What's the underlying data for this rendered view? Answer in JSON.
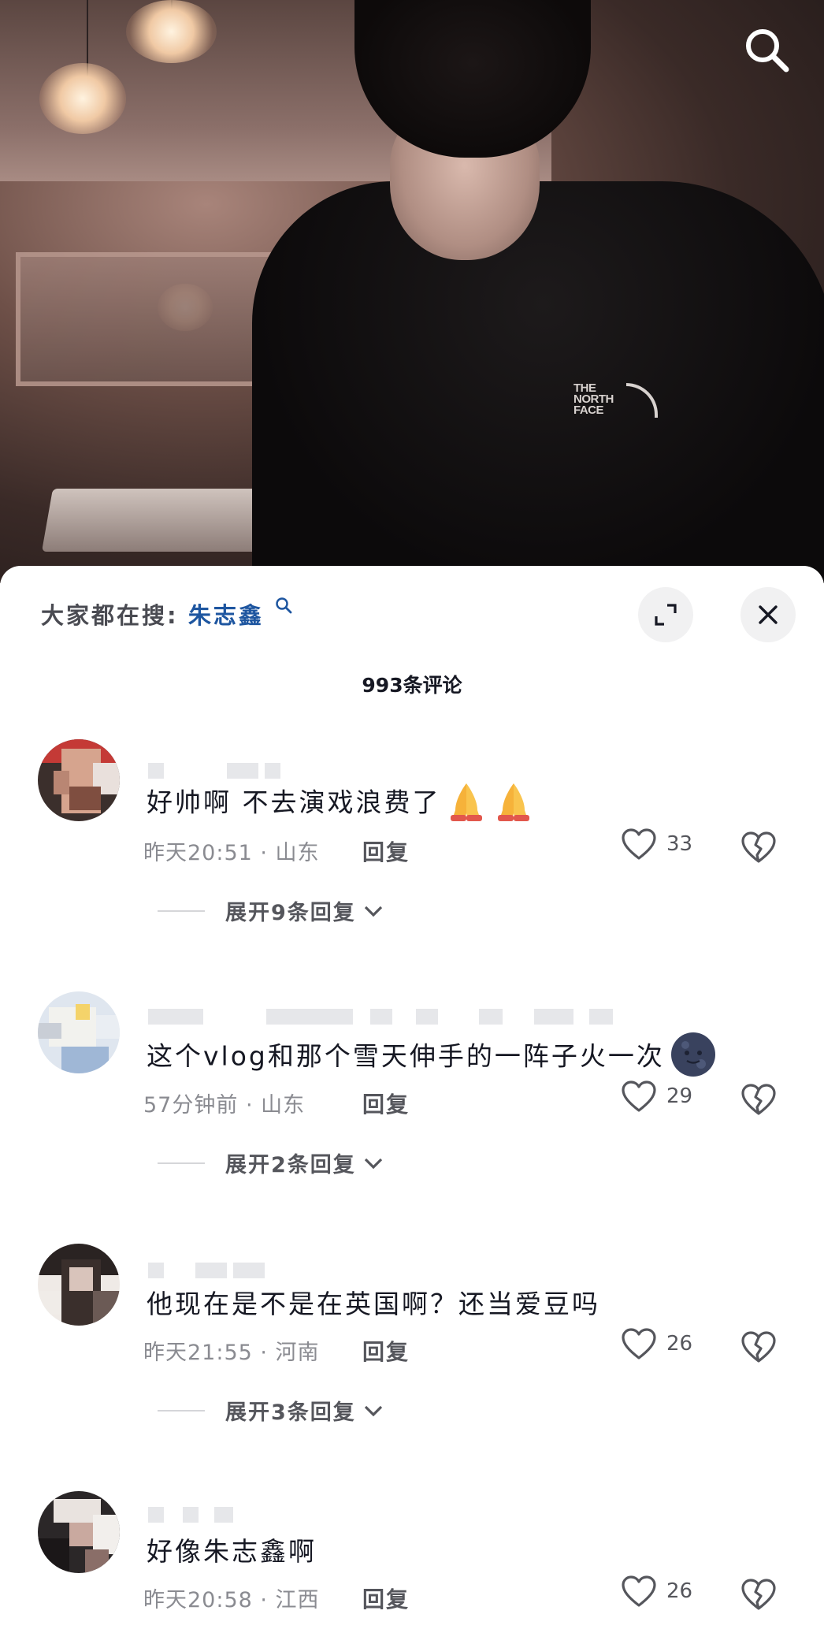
{
  "header": {
    "search_icon": "search-icon",
    "brand_lines": [
      "THE",
      "NORTH",
      "FACE"
    ]
  },
  "sheet": {
    "hot_search_prefix": "大家都在搜:",
    "hot_search_keyword": "朱志鑫",
    "comment_count_label": "993条评论",
    "expand_icon": "expand-icon",
    "close_icon": "close-icon"
  },
  "comments": [
    {
      "text": "好帅啊 不去演戏浪费了",
      "emoji": [
        "🙏",
        "🙏"
      ],
      "meta": "昨天20:51 · 山东",
      "reply_label": "回复",
      "likes": "33",
      "expand_label": "展开9条回复"
    },
    {
      "text": "这个vlog和那个雪天伸手的一阵子火一次",
      "emoji": [
        "🌚"
      ],
      "meta": "57分钟前 · 山东",
      "reply_label": "回复",
      "likes": "29",
      "expand_label": "展开2条回复"
    },
    {
      "text": "他现在是不是在英国啊？还当爱豆吗",
      "meta": "昨天21:55 · 河南",
      "reply_label": "回复",
      "likes": "26",
      "expand_label": "展开3条回复"
    },
    {
      "text": "好像朱志鑫啊",
      "meta": "昨天20:58 · 江西",
      "reply_label": "回复",
      "likes": "26"
    }
  ],
  "colors": {
    "keyword_blue": "#1e56a0",
    "text_primary": "#161823",
    "text_secondary": "#8a8b91"
  }
}
